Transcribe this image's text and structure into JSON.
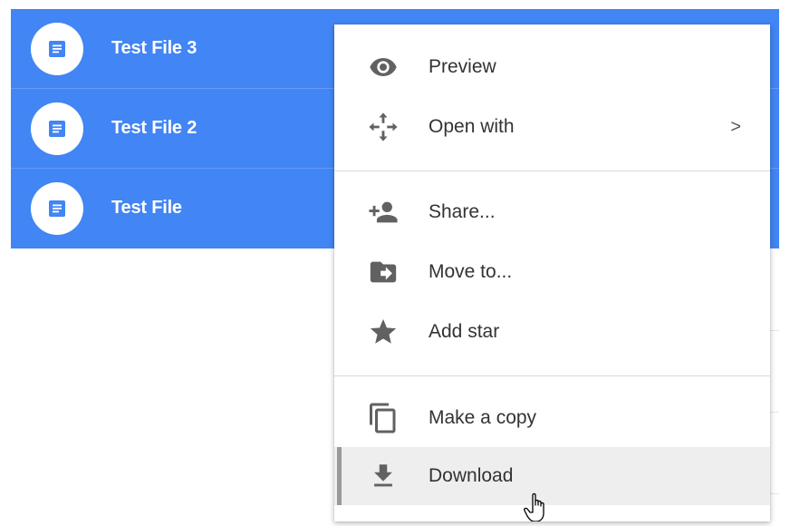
{
  "file_list": {
    "files": [
      {
        "name": "Test File 3",
        "icon": "doc-icon"
      },
      {
        "name": "Test File 2",
        "icon": "doc-icon"
      },
      {
        "name": "Test File",
        "icon": "doc-icon"
      }
    ]
  },
  "context_menu": {
    "items": [
      {
        "label": "Preview",
        "icon": "eye-icon"
      },
      {
        "label": "Open with",
        "icon": "move-arrows-icon",
        "submenu_indicator": ">"
      },
      {
        "label": "Share...",
        "icon": "add-person-icon"
      },
      {
        "label": "Move to...",
        "icon": "folder-move-icon"
      },
      {
        "label": "Add star",
        "icon": "star-icon"
      },
      {
        "label": "Make a copy",
        "icon": "copy-icon"
      },
      {
        "label": "Download",
        "icon": "download-icon",
        "hovered": true
      }
    ]
  },
  "colors": {
    "selection_blue": "#4285f4",
    "icon_gray": "#616161",
    "hover_gray": "#eeeeee"
  }
}
